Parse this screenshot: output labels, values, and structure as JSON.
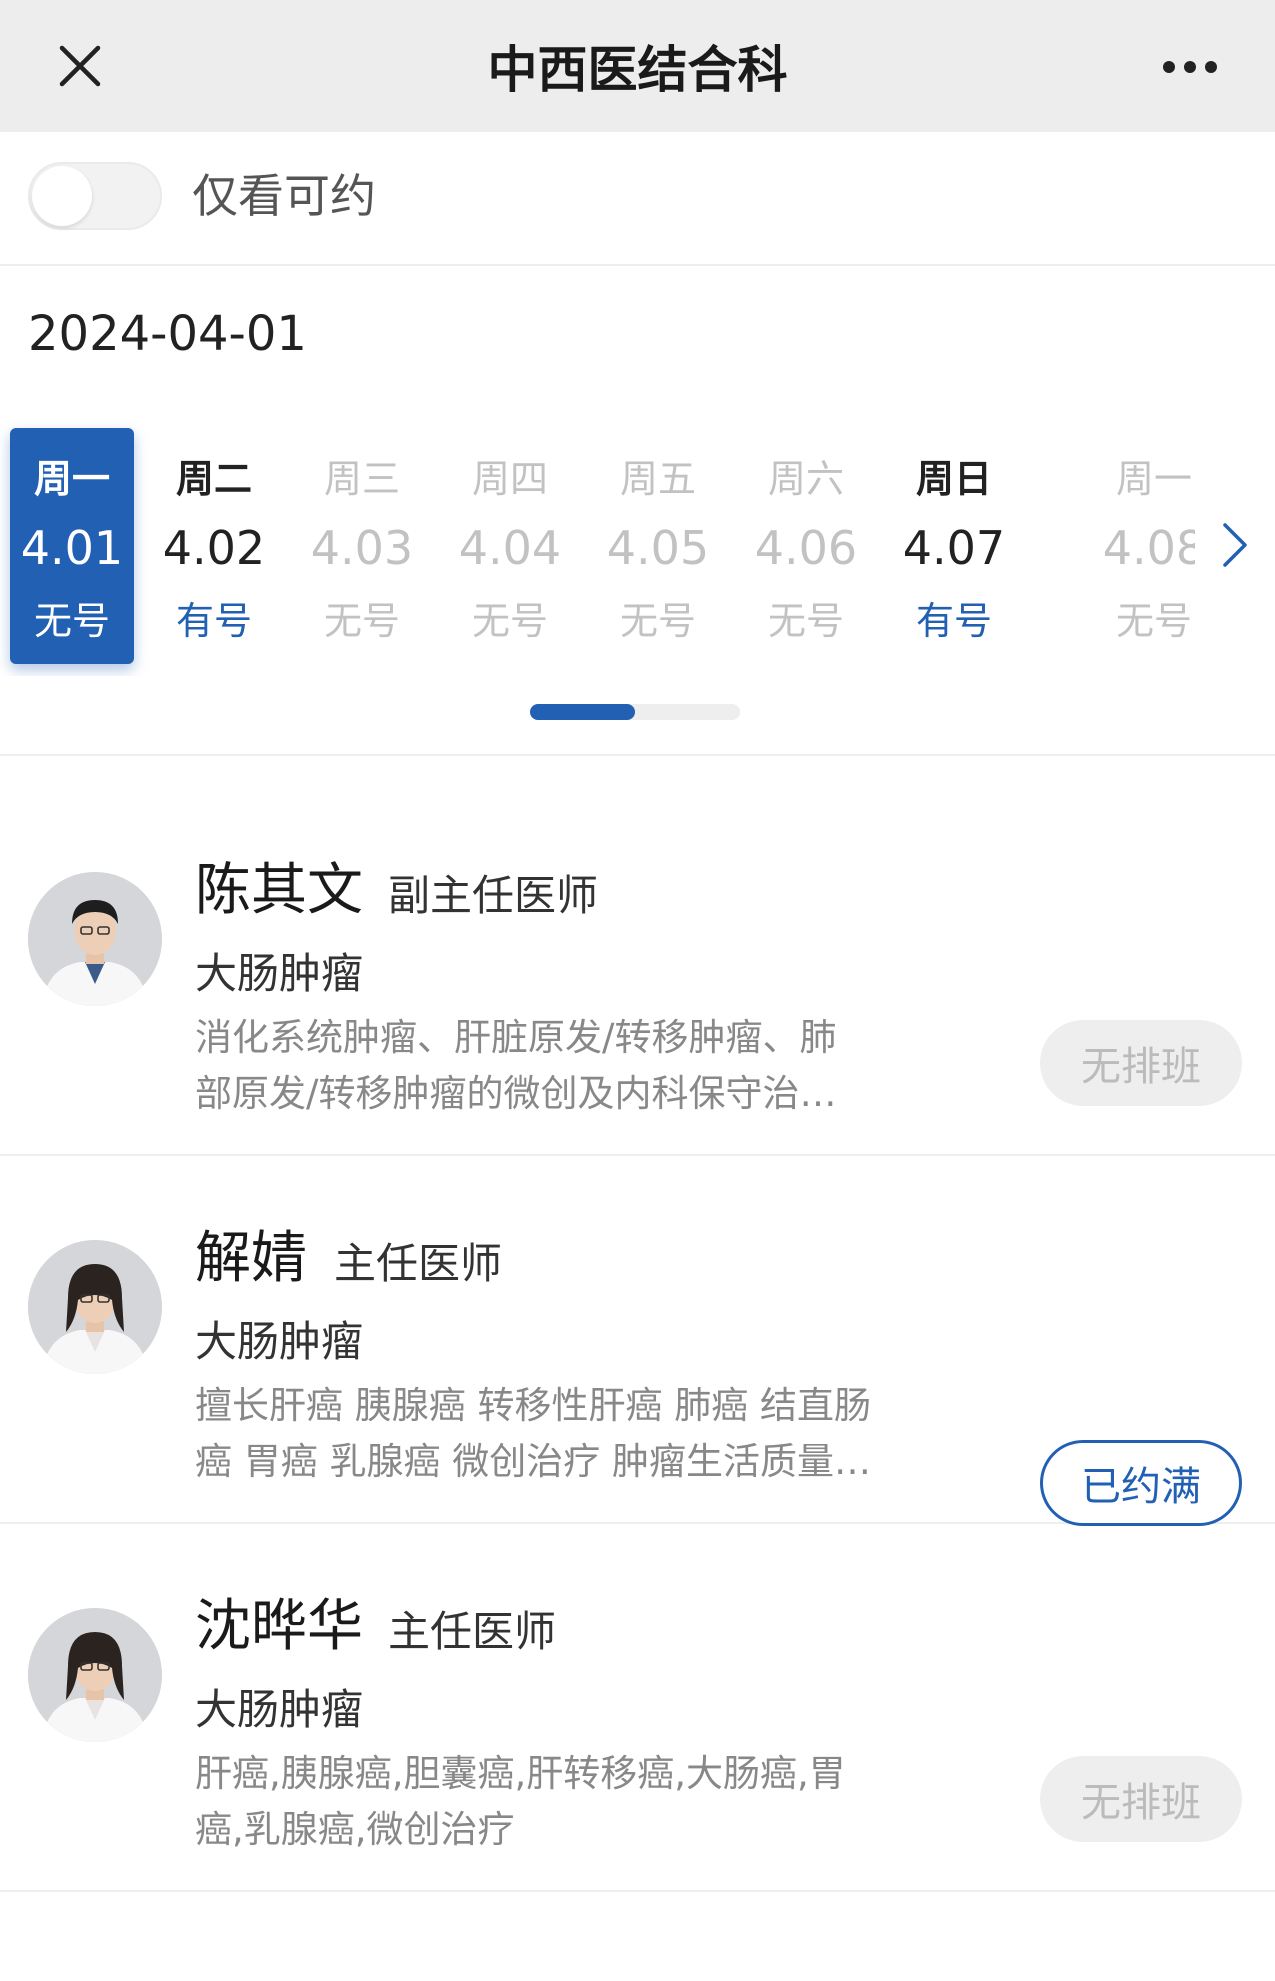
{
  "header": {
    "title": "中西医结合科",
    "close_icon": "close-icon",
    "more_icon": "more-horizontal-icon"
  },
  "filter": {
    "toggle_label": "仅看可约",
    "toggle_on": false
  },
  "selected_date": "2024-04-01",
  "days": [
    {
      "week": "周一",
      "date": "4.01",
      "availability": "无号",
      "state": "selected"
    },
    {
      "week": "周二",
      "date": "4.02",
      "availability": "有号",
      "state": "active"
    },
    {
      "week": "周三",
      "date": "4.03",
      "availability": "无号",
      "state": "muted"
    },
    {
      "week": "周四",
      "date": "4.04",
      "availability": "无号",
      "state": "muted"
    },
    {
      "week": "周五",
      "date": "4.05",
      "availability": "无号",
      "state": "muted"
    },
    {
      "week": "周六",
      "date": "4.06",
      "availability": "无号",
      "state": "muted"
    },
    {
      "week": "周日",
      "date": "4.07",
      "availability": "有号",
      "state": "active"
    },
    {
      "week": "周一",
      "date": "4.08",
      "availability": "无号",
      "state": "muted"
    }
  ],
  "strip_next_icon": "chevron-right-icon",
  "scroll_progress": 0.5,
  "doctors": [
    {
      "name": "陈其文",
      "title": "副主任医师",
      "department": "大肠肿瘤",
      "description": "消化系统肿瘤、肝脏原发/转移肿瘤、肺\n部原发/转移肿瘤的微创及内科保守治…",
      "status": "无排班",
      "status_type": "none",
      "avatar": "avatar-male-doctor"
    },
    {
      "name": "解婧",
      "title": "主任医师",
      "department": "大肠肿瘤",
      "description": "擅长肝癌 胰腺癌 转移性肝癌 肺癌 结直肠\n癌 胃癌 乳腺癌 微创治疗 肿瘤生活质量…",
      "status": "已约满",
      "status_type": "full",
      "avatar": "avatar-female-doctor"
    },
    {
      "name": "沈晔华",
      "title": "主任医师",
      "department": "大肠肿瘤",
      "description": "肝癌,胰腺癌,胆囊癌,肝转移癌,大肠癌,胃\n癌,乳腺癌,微创治疗",
      "status": "无排班",
      "status_type": "none",
      "avatar": "avatar-female-doctor"
    }
  ],
  "colors": {
    "accent": "#2260b3",
    "header_bg": "#ededed",
    "muted_text": "#c2c2c2",
    "desc_text": "#888888"
  }
}
